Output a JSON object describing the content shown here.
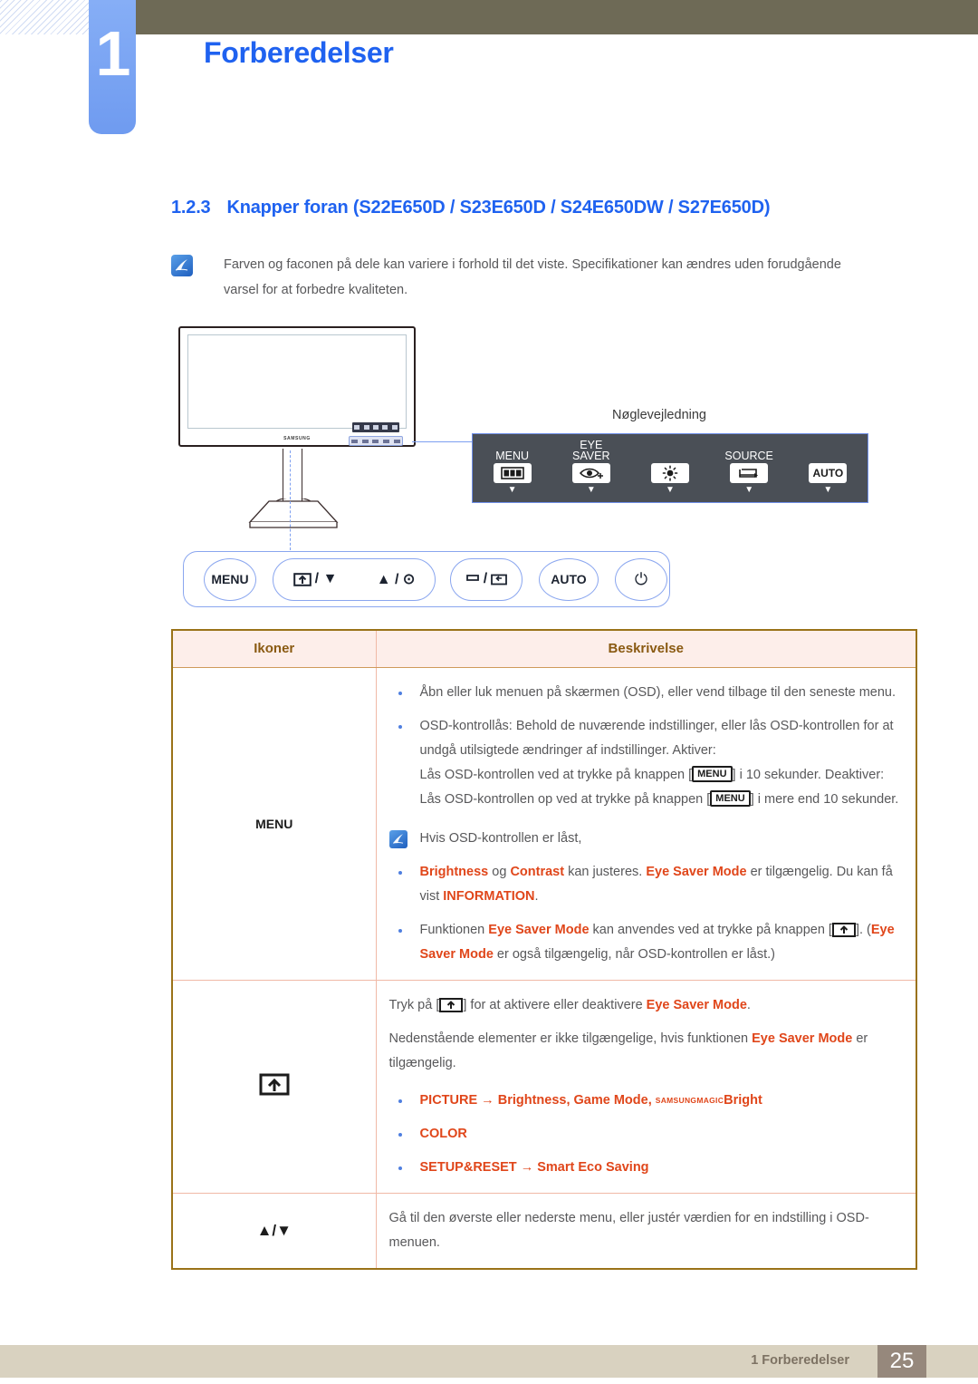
{
  "header": {
    "chapter_number": "1",
    "chapter_title": "Forberedelser"
  },
  "section": {
    "number": "1.2.3",
    "title": "Knapper foran (S22E650D / S23E650D / S24E650DW / S27E650D)",
    "note": "Farven og faconen på dele kan variere i forhold til det viste. Specifikationer kan ændres uden forudgående varsel for at forbedre kvaliteten."
  },
  "monitor": {
    "brand_logo": "SAMSUNG"
  },
  "key_guide": {
    "label": "Nøglevejledning",
    "items": [
      {
        "caption_line1": "",
        "caption_line2": "MENU",
        "icon": "menu-bars-icon",
        "arrow": "▼"
      },
      {
        "caption_line1": "EYE",
        "caption_line2": "SAVER",
        "icon": "eye-plus-icon",
        "arrow": "▼"
      },
      {
        "caption_line1": "",
        "caption_line2": "",
        "icon": "brightness-icon",
        "arrow": "▼"
      },
      {
        "caption_line1": "",
        "caption_line2": "SOURCE",
        "icon": "source-loop-icon",
        "arrow": "▼"
      },
      {
        "caption_line1": "",
        "caption_line2": "",
        "icon": "auto-text-icon",
        "arrow": "▼",
        "text": "AUTO"
      }
    ]
  },
  "button_strip": {
    "buttons": [
      {
        "name": "menu-button",
        "label": "MENU"
      },
      {
        "name": "eyesaver-down-button",
        "label": "/ ▼"
      },
      {
        "name": "up-enter-button",
        "label": "▲ / ⊙"
      },
      {
        "name": "source-return-button",
        "label": "/"
      },
      {
        "name": "auto-button",
        "label": "AUTO"
      },
      {
        "name": "power-button",
        "label": "⏻"
      }
    ]
  },
  "table": {
    "headers": {
      "icons": "Ikoner",
      "description": "Beskrivelse"
    },
    "rows": [
      {
        "icon_label": "MENU",
        "icon_kind": "text",
        "bullets": [
          "Åbn eller luk menuen på skærmen (OSD), eller vend tilbage til den seneste menu.",
          "OSD-kontrollås: Behold de nuværende indstillinger, eller lås OSD-kontrollen for at undgå utilsigtede ændringer af indstillinger. Aktiver:"
        ],
        "lock_line_1_pre": "Lås OSD-kontrollen ved at trykke på knappen [",
        "lock_key": "MENU",
        "lock_line_1_post": "] i 10 sekunder.",
        "lock_line_2_pre": "Deaktiver: Lås OSD-kontrollen op ved at trykke på knappen [",
        "lock_line_2_post": "] i mere end 10 sekunder.",
        "subnote": "Hvis OSD-kontrollen er låst,",
        "sub_bullets": [
          {
            "parts": [
              {
                "t": "Brightness",
                "s": "or"
              },
              {
                "t": " og ",
                "s": "n"
              },
              {
                "t": "Contrast",
                "s": "or"
              },
              {
                "t": " kan justeres. ",
                "s": "n"
              },
              {
                "t": "Eye Saver Mode",
                "s": "or"
              },
              {
                "t": " er tilgængelig. Du kan få vist ",
                "s": "n"
              },
              {
                "t": "INFORMATION",
                "s": "or"
              },
              {
                "t": ".",
                "s": "n"
              }
            ]
          },
          {
            "parts": [
              {
                "t": "Funktionen ",
                "s": "n"
              },
              {
                "t": "Eye Saver Mode",
                "s": "or"
              },
              {
                "t": " kan anvendes ved at trykke på knappen [",
                "s": "n"
              },
              {
                "t": "ICON",
                "s": "icon"
              },
              {
                "t": "]. (",
                "s": "n"
              },
              {
                "t": "Eye Saver Mode",
                "s": "or"
              },
              {
                "t": " er også tilgængelig, når OSD-kontrollen er låst.)",
                "s": "n"
              }
            ]
          }
        ]
      },
      {
        "icon_label": "eye-saver-icon",
        "icon_kind": "glyph",
        "line1_parts": [
          {
            "t": "Tryk på [",
            "s": "n"
          },
          {
            "t": "ICON",
            "s": "icon"
          },
          {
            "t": "] for at aktivere eller deaktivere ",
            "s": "n"
          },
          {
            "t": "Eye Saver Mode",
            "s": "or"
          },
          {
            "t": ".",
            "s": "n"
          }
        ],
        "line2_parts": [
          {
            "t": "Nedenstående elementer er ikke tilgængelige, hvis funktionen ",
            "s": "n"
          },
          {
            "t": "Eye Saver Mode",
            "s": "or"
          },
          {
            "t": " er tilgængelig.",
            "s": "n"
          }
        ],
        "menu_bullets": [
          {
            "pre": "PICTURE",
            "arrow": " → ",
            "post": "Brightness, Game Mode, ",
            "magic1": "SAMSUNG",
            "magic2": "MAGIC",
            "magic_tail": "Bright"
          },
          {
            "pre": "COLOR",
            "arrow": "",
            "post": ""
          },
          {
            "pre": "SETUP&RESET",
            "arrow": " → ",
            "post": "Smart Eco Saving"
          }
        ]
      },
      {
        "icon_label": "▲/▼",
        "icon_kind": "text",
        "text": "Gå til den øverste eller nederste menu, eller justér værdien for en indstilling i OSD-menuen."
      }
    ]
  },
  "footer": {
    "text": "1 Forberedelser",
    "page": "25"
  },
  "colors": {
    "accent_blue": "#1f62f0",
    "header_olive": "#6e6a56",
    "orange": "#e0461a",
    "table_border": "#9a7218",
    "footer_bg": "#d9d2c0"
  }
}
